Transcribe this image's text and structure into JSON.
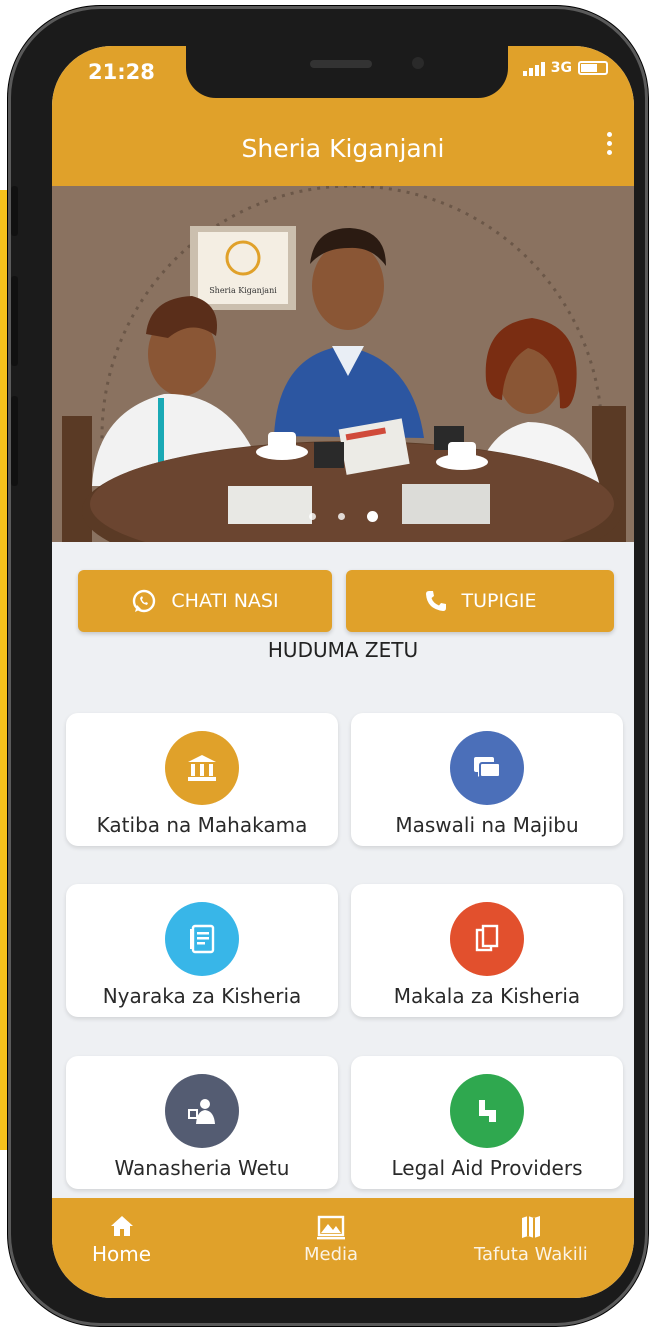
{
  "status_bar": {
    "time": "21:28",
    "network": "3G"
  },
  "app_bar": {
    "title": "Sheria Kiganjani"
  },
  "banner": {
    "sign_text": "Sheria Kiganjani"
  },
  "actions": {
    "chat_label": "CHATI NASI",
    "call_label": "TUPIGIE"
  },
  "section": {
    "title": "HUDUMA ZETU"
  },
  "services": [
    {
      "label": "Katiba na Mahakama",
      "icon": "courthouse-icon",
      "color": "#e0a12a"
    },
    {
      "label": "Maswali na Majibu",
      "icon": "chat-bubbles-icon",
      "color": "#4b6fb9"
    },
    {
      "label": "Nyaraka za Kisheria",
      "icon": "document-book-icon",
      "color": "#38b6e8"
    },
    {
      "label": "Makala za Kisheria",
      "icon": "articles-icon",
      "color": "#e2502d"
    },
    {
      "label": "Wanasheria Wetu",
      "icon": "lawyer-icon",
      "color": "#545c72"
    },
    {
      "label": "Legal Aid Providers",
      "icon": "aid-icon",
      "color": "#2fa84f"
    }
  ],
  "bottom_nav": {
    "home": "Home",
    "media": "Media",
    "tafuta": "Tafuta Wakili"
  },
  "colors": {
    "brand": "#e0a12a",
    "background": "#eef0f3"
  }
}
